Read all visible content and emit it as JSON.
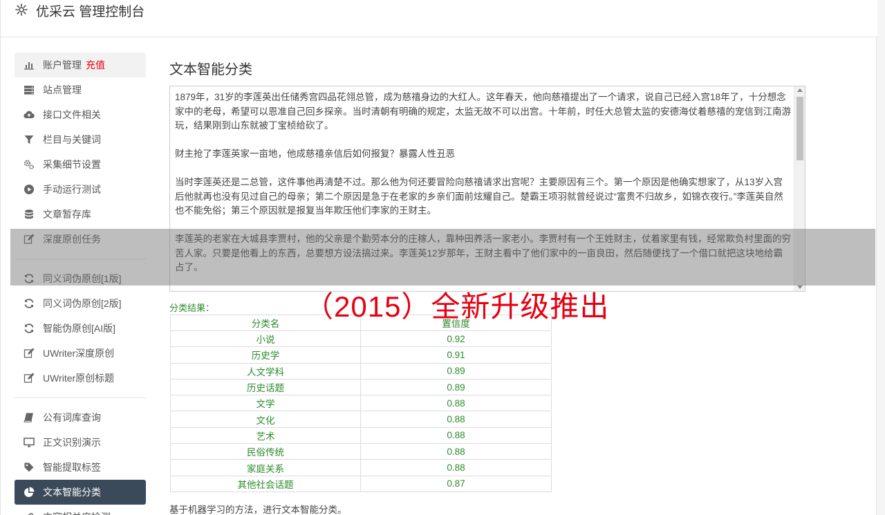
{
  "app": {
    "title": "优采云 管理控制台"
  },
  "sidebar": {
    "group1": [
      {
        "label": "账户管理",
        "badge": "充值",
        "icon": "bar-chart-icon"
      },
      {
        "label": "站点管理",
        "icon": "server-icon"
      },
      {
        "label": "接口文件相关",
        "icon": "cloud-upload-icon"
      },
      {
        "label": "栏目与关键词",
        "icon": "filter-icon"
      },
      {
        "label": "采集细节设置",
        "icon": "gears-icon"
      },
      {
        "label": "手动运行测试",
        "icon": "play-circle-icon"
      },
      {
        "label": "文章暂存库",
        "icon": "database-icon"
      },
      {
        "label": "深度原创任务",
        "icon": "edit-icon"
      }
    ],
    "group2": [
      {
        "label": "同义词伪原创[1版]",
        "icon": "refresh-icon"
      },
      {
        "label": "同义词伪原创[2版]",
        "icon": "refresh-icon"
      },
      {
        "label": "智能伪原创[AI版]",
        "icon": "refresh-icon"
      },
      {
        "label": "UWriter深度原创",
        "icon": "edit-icon"
      },
      {
        "label": "UWriter原创标题",
        "icon": "edit-icon"
      }
    ],
    "group3": [
      {
        "label": "公有词库查询",
        "icon": "book-icon"
      },
      {
        "label": "正文识别演示",
        "icon": "desktop-icon"
      },
      {
        "label": "智能提取标签",
        "icon": "tag-icon"
      },
      {
        "label": "文本智能分类",
        "icon": "pie-chart-icon"
      },
      {
        "label": "内容相关度检测",
        "icon": "link-icon"
      }
    ]
  },
  "main": {
    "title": "文本智能分类",
    "text": "1879年，31岁的李莲英出任储秀宫四品花翎总管，成为慈禧身边的大红人。这年春天，他向慈禧提出了一个请求，说自己已经入宫18年了，十分想念家中的老母，希望可以恩准自己回乡探亲。当时清朝有明确的规定，太监无故不可以出宫。十年前，时任大总管太监的安德海仗着慈禧的宠信到江南游玩，结果刚到山东就被丁宝桢给砍了。\n\n财主抢了李莲英家一亩地，他成慈禧亲信后如何报复？暴露人性丑恶\n\n当时李莲英还是二总管，这件事他再清楚不过。那么他为何还要冒险向慈禧请求出宫呢？主要原因有三个。第一个原因是他确实想家了，从13岁入宫后他就再也没有见过自己的母亲；第二个原因是急于在老家的乡亲们面前炫耀自己。楚霸王项羽就曾经说过“富贵不归故乡，如锦衣夜行。”李莲英自然也不能免俗；第三个原因就是报复当年欺压他们李家的王财主。\n\n李莲英的老家在大城县李贾村，他的父亲是个勤劳本分的庄稼人，靠种田养活一家老小。李贾村有一个王姓财主，仗着家里有钱，经常欺负村里面的穷苦人家。只要是他看上的东西，总要想方设法搞过来。李莲英12岁那年，王财主看中了他们家中的一亩良田，然后随便找了一个借口就把这块地给霸占了。\n\n财主抢了李莲英家一亩地，他成慈禧亲信后如何报复？暴露人性丑恶",
    "banner": "（2015）全新升级推出",
    "result_label": "分类结果：",
    "table": {
      "headers": [
        "分类名",
        "置信度"
      ],
      "rows": [
        [
          "小说",
          "0.92"
        ],
        [
          "历史学",
          "0.91"
        ],
        [
          "人文学科",
          "0.89"
        ],
        [
          "历史话题",
          "0.89"
        ],
        [
          "文学",
          "0.88"
        ],
        [
          "文化",
          "0.88"
        ],
        [
          "艺术",
          "0.88"
        ],
        [
          "民俗传统",
          "0.88"
        ],
        [
          "家庭关系",
          "0.88"
        ],
        [
          "其他社会话题",
          "0.87"
        ]
      ]
    },
    "footnote": "基于机器学习的方法，进行文本智能分类。"
  },
  "colors": {
    "accent_red": "#e60012",
    "result_green": "#2a8a2a",
    "active_nav": "#3b4a5a"
  }
}
